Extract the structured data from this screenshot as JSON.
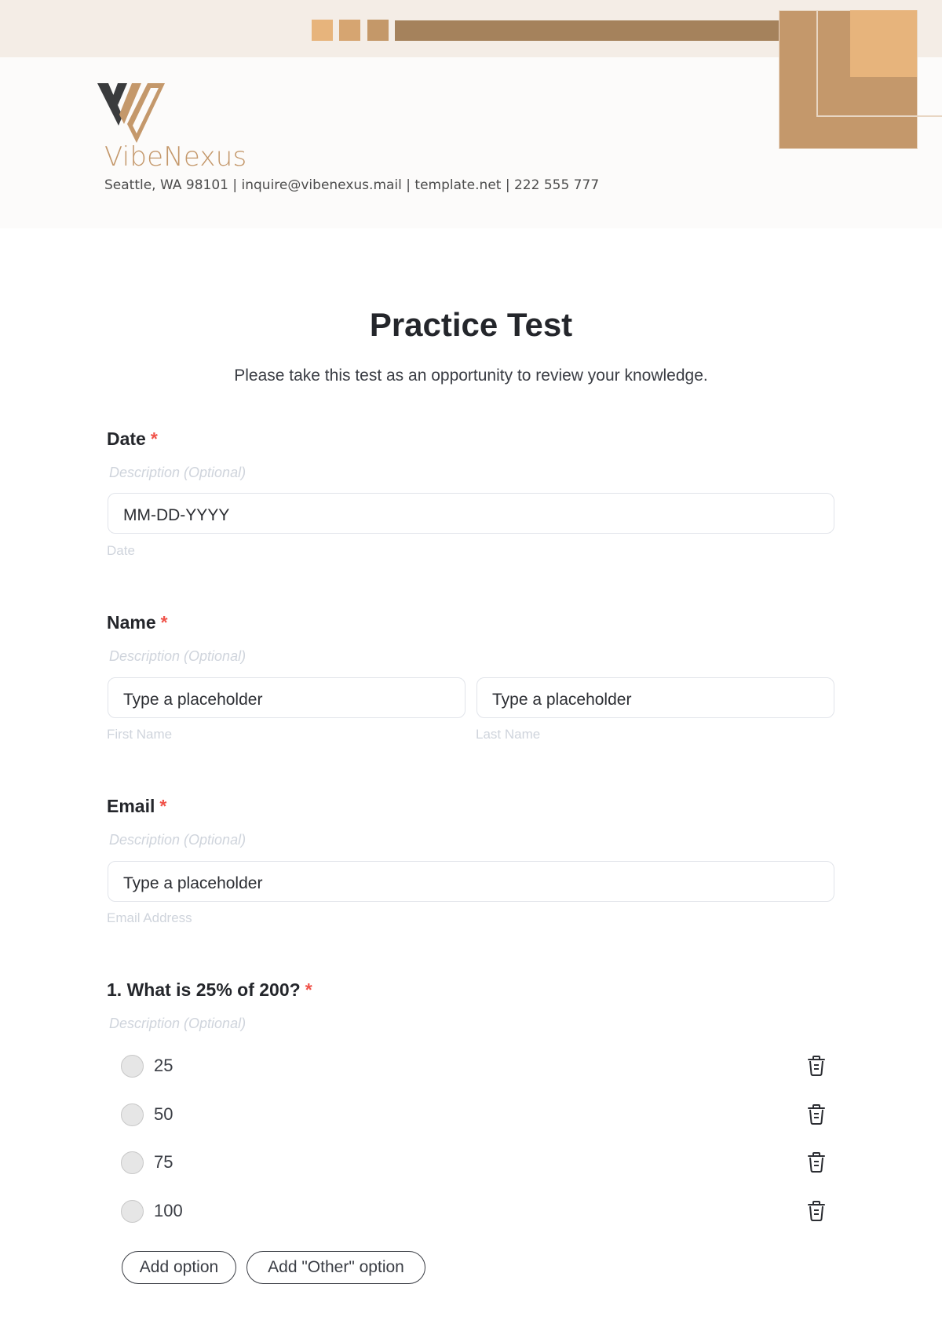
{
  "header": {
    "brand_name": "VibeNexus",
    "contact_line": "Seattle, WA 98101 | inquire@vibenexus.mail | template.net | 222 555 777",
    "colors": {
      "accent": "#c4986b",
      "light_accent": "#e7b47c",
      "dark_bar": "#a5825c",
      "band": "#f4ede6"
    }
  },
  "form": {
    "title": "Practice Test",
    "subtitle": "Please take this test as an opportunity to review your knowledge.",
    "required_marker": "*",
    "fields": [
      {
        "label": "Date",
        "description_placeholder": "Description (Optional)",
        "inputs": [
          {
            "placeholder": "MM-DD-YYYY",
            "sublabel": "Date"
          }
        ]
      },
      {
        "label": "Name",
        "description_placeholder": "Description (Optional)",
        "inputs": [
          {
            "placeholder": "Type a placeholder",
            "sublabel": "First Name"
          },
          {
            "placeholder": "Type a placeholder",
            "sublabel": "Last Name"
          }
        ]
      },
      {
        "label": "Email",
        "description_placeholder": "Description (Optional)",
        "inputs": [
          {
            "placeholder": "Type a placeholder",
            "sublabel": "Email Address"
          }
        ]
      }
    ],
    "questions": [
      {
        "label": "1. What is 25% of 200?",
        "description_placeholder": "Description (Optional)",
        "options": [
          "25",
          "50",
          "75",
          "100"
        ],
        "option_icon": "trash-icon",
        "add_option_label": "Add option",
        "add_other_label": "Add \"Other\" option"
      }
    ]
  }
}
